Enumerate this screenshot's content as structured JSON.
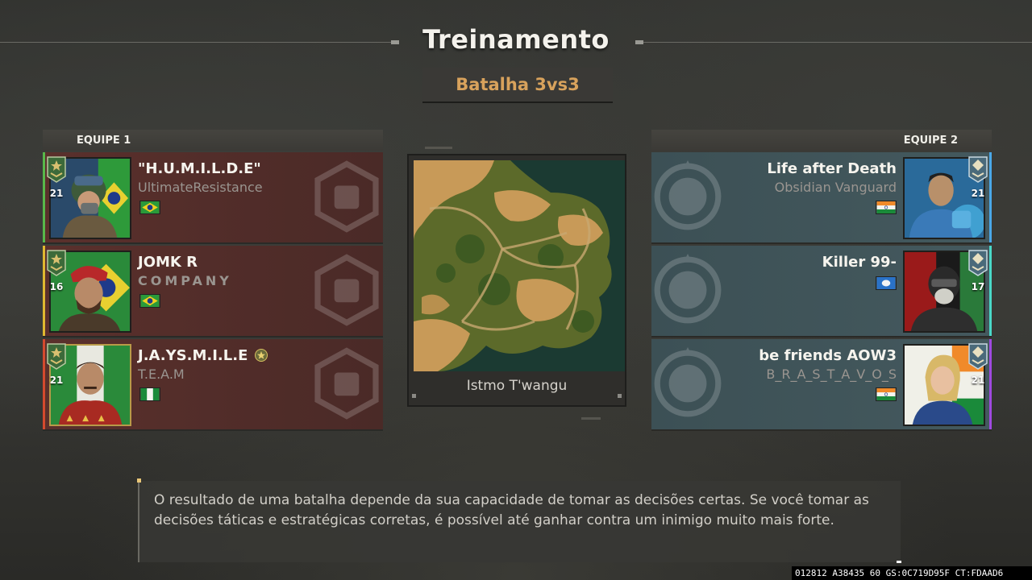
{
  "header": {
    "title": "Treinamento",
    "mode": "Batalha 3vs3"
  },
  "team1": {
    "label": "EQUIPE 1",
    "players": [
      {
        "name": "\"H.U.M.I.L.D.E\"",
        "clan": "UltimateResistance",
        "level": "21",
        "flag": "brazil",
        "edge_color": "#58b84a"
      },
      {
        "name": "JOMK R",
        "clan": "COMPANY",
        "level": "16",
        "flag": "brazil",
        "edge_color": "#e0b830"
      },
      {
        "name": "J.A.YS.M.I.L.E",
        "clan": "T.E.A.M",
        "level": "21",
        "flag": "nigeria",
        "edge_color": "#d44a2e",
        "verified_badge": "star-badge-icon"
      }
    ]
  },
  "team2": {
    "label": "EQUIPE 2",
    "players": [
      {
        "name": "Life after Death",
        "clan": "Obsidian Vanguard",
        "level": "21",
        "flag": "india",
        "edge_color": "#4aa8e8"
      },
      {
        "name": "Killer 99-",
        "clan": "",
        "level": "17",
        "flag": "antarctica",
        "edge_color": "#4ad8c8"
      },
      {
        "name": "be friends AOW3",
        "clan": "B_R_A_S_T_A_V_O_S",
        "level": "21",
        "flag": "india",
        "edge_color": "#a04ae0"
      }
    ]
  },
  "map": {
    "name": "Istmo T'wangu"
  },
  "tip": {
    "text": "O resultado de uma batalha depende da sua capacidade de tomar as decisões certas. Se você tomar as decisões táticas e estratégicas corretas, é possível até ganhar contra um inimigo muito mais forte."
  },
  "debug": {
    "text": "012812 A38435 60 GS:0C719D95F CT:FDAAD6"
  },
  "colors": {
    "accent": "#d8a25c",
    "team1_bg": "#4e2c29",
    "team2_bg": "#3f5358"
  }
}
